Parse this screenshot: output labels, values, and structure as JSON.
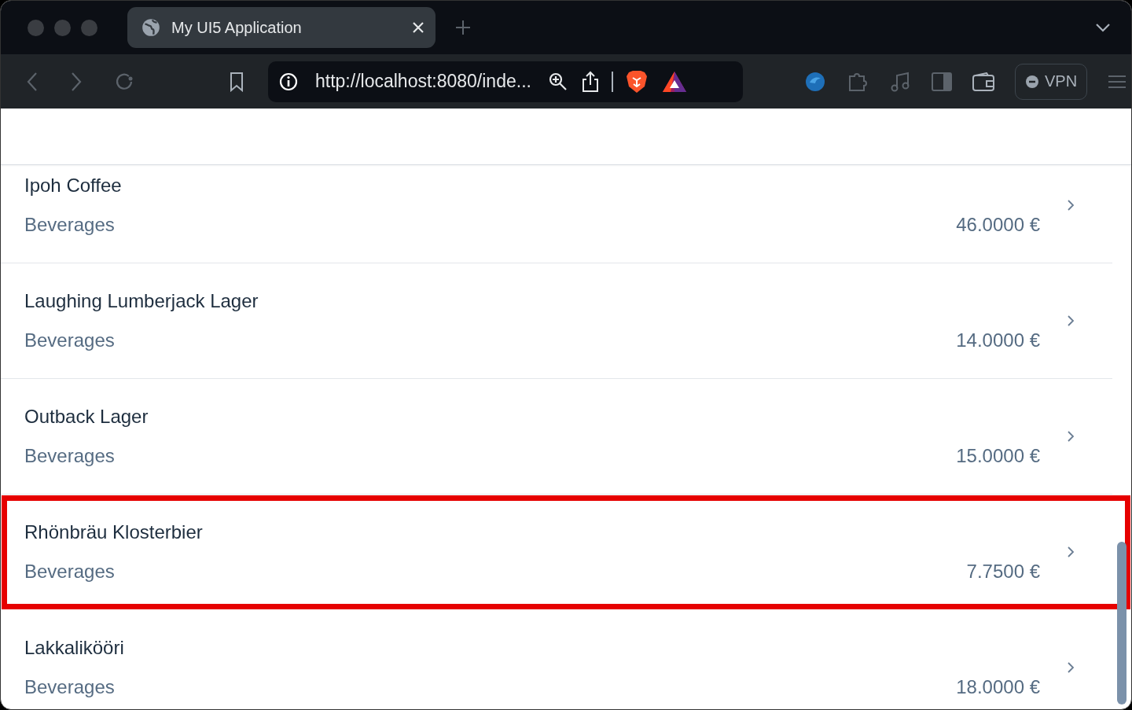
{
  "browser": {
    "tab": {
      "title": "My UI5 Application"
    },
    "address": "http://localhost:8080/inde...",
    "vpn_label": "VPN"
  },
  "list": {
    "items": [
      {
        "title": "Ipoh Coffee",
        "category": "Beverages",
        "price": "46.0000 €",
        "highlighted": false
      },
      {
        "title": "Laughing Lumberjack Lager",
        "category": "Beverages",
        "price": "14.0000 €",
        "highlighted": false
      },
      {
        "title": "Outback Lager",
        "category": "Beverages",
        "price": "15.0000 €",
        "highlighted": false
      },
      {
        "title": "Rhönbräu Klosterbier",
        "category": "Beverages",
        "price": "7.7500 €",
        "highlighted": true
      },
      {
        "title": "Lakkalikööri",
        "category": "Beverages",
        "price": "18.0000 €",
        "highlighted": false
      }
    ]
  }
}
